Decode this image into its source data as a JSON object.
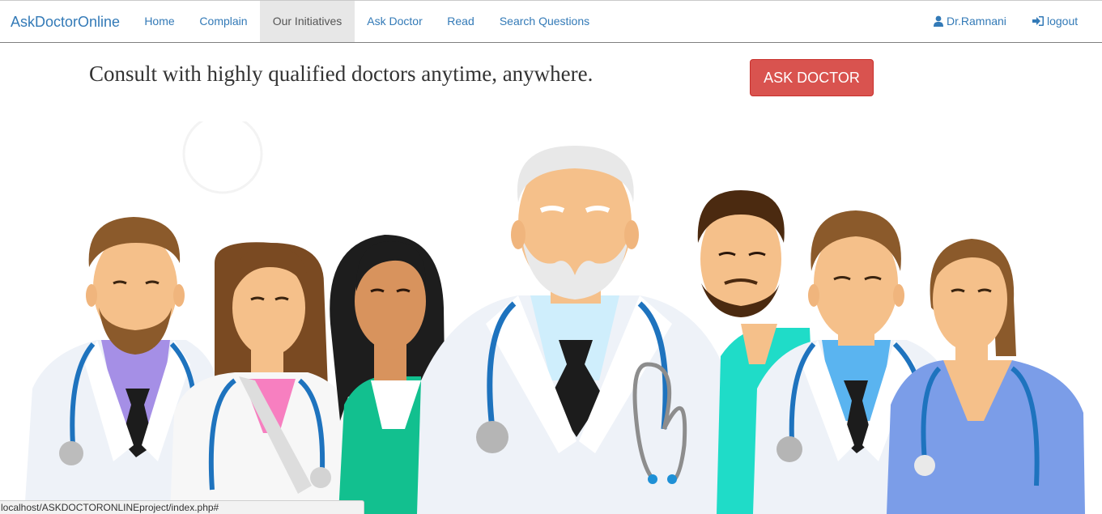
{
  "navbar": {
    "brand": "AskDoctorOnline",
    "items": [
      {
        "label": "Home",
        "active": false
      },
      {
        "label": "Complain",
        "active": false
      },
      {
        "label": "Our Initiatives",
        "active": true
      },
      {
        "label": "Ask Doctor",
        "active": false
      },
      {
        "label": "Read",
        "active": false
      },
      {
        "label": "Search Questions",
        "active": false
      }
    ],
    "user": {
      "label": "Dr.Ramnani",
      "icon": "user-icon"
    },
    "logout": {
      "label": "logout",
      "icon": "log-in-icon"
    }
  },
  "hero": {
    "tagline": "Consult with highly qualified doctors anytime, anywhere.",
    "button_label": "ASK DOCTOR",
    "illustration": "group-of-doctors-illustration"
  },
  "status_bar": {
    "url": "localhost/ASKDOCTORONLINEproject/index.php#"
  },
  "colors": {
    "link": "#337ab7",
    "active_nav_bg": "#e7e7e7",
    "danger_button": "#d9534f",
    "stethoscope": "#1e73be",
    "skin": "#f5c08a"
  }
}
